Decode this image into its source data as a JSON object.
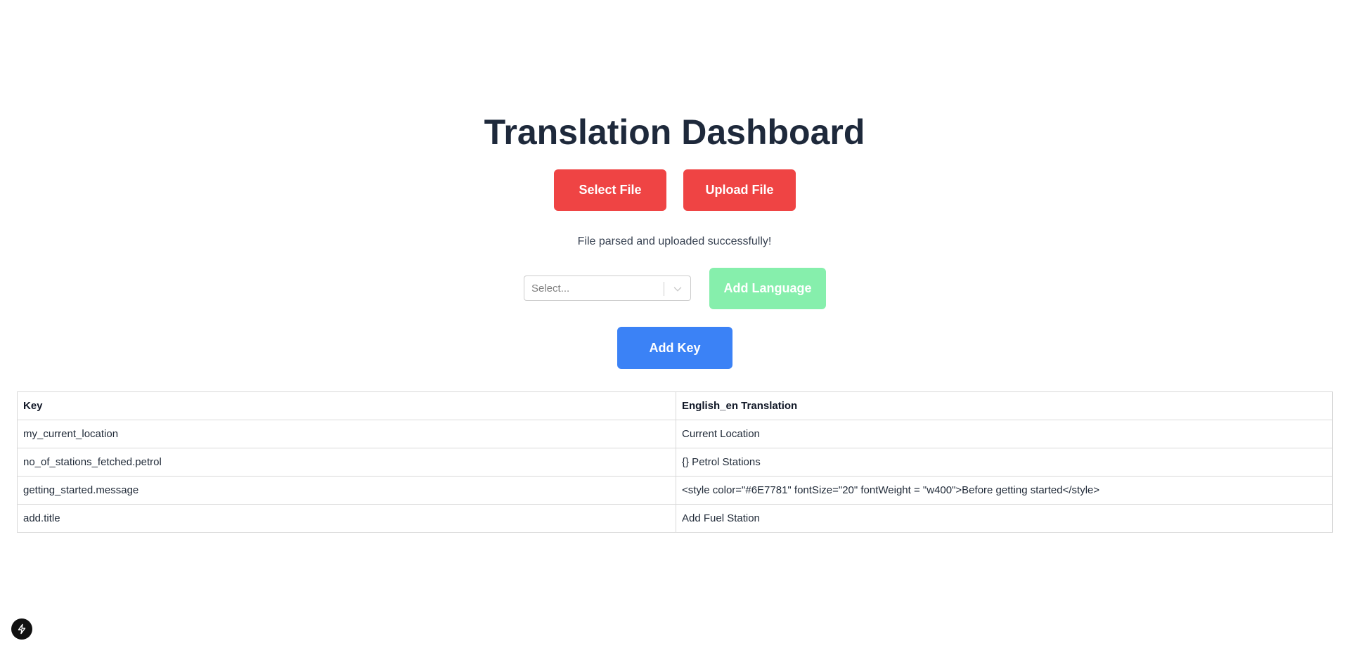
{
  "header": {
    "title": "Translation Dashboard"
  },
  "actions": {
    "select_file_label": "Select File",
    "upload_file_label": "Upload File",
    "add_language_label": "Add Language",
    "add_key_label": "Add Key"
  },
  "status": {
    "message": "File parsed and uploaded successfully!"
  },
  "language_select": {
    "placeholder": "Select..."
  },
  "table": {
    "headers": [
      "Key",
      "English_en Translation"
    ],
    "rows": [
      [
        "my_current_location",
        "Current Location"
      ],
      [
        "no_of_stations_fetched.petrol",
        "{} Petrol Stations"
      ],
      [
        "getting_started.message",
        "<style color=\"#6E7781\" fontSize=\"20\" fontWeight = \"w400\">Before getting started</style>"
      ],
      [
        "add.title",
        "Add Fuel Station"
      ]
    ]
  },
  "colors": {
    "primary_red": "#ef4444",
    "disabled_green": "#86efac",
    "primary_blue": "#3b82f6",
    "title_text": "#1e293b"
  },
  "icons": {
    "select_indicator": "chevron-down-icon",
    "fab": "lightning-bolt-icon"
  }
}
